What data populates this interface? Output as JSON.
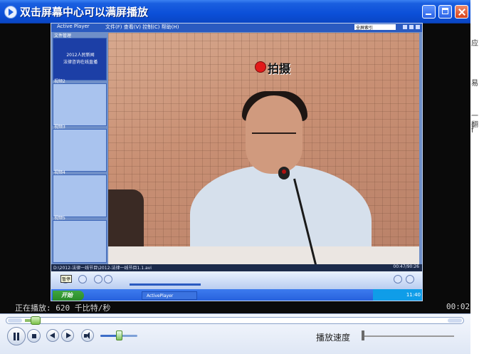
{
  "window": {
    "title": "双击屏幕中心可以满屏播放"
  },
  "inner_screen": {
    "app_name": "Active Player",
    "menu": "文件(F)  查看(V)  控制(C)  帮助(H)",
    "select_value": "全屏索引",
    "thumbs": [
      {
        "label": "文件管理",
        "lines": [
          "2012人民新闻",
          "法律咨询在线直播"
        ]
      },
      {
        "label": "视频2",
        "lines": []
      },
      {
        "label": "视频3",
        "lines": []
      },
      {
        "label": "视频4",
        "lines": []
      },
      {
        "label": "视频5",
        "lines": []
      }
    ],
    "recording_text": "拍摄",
    "status_left": "D:\\2012-法律一线节目\\2012-法律一线节目1.1.avi",
    "status_right": "00:47/90:26",
    "tooltip": "暂停",
    "start_label": "开始",
    "task_item": "ActivePlayer",
    "tray_time": "11:40"
  },
  "status": {
    "playing": "正在播放: 620 千比特/秒",
    "time": "00:02"
  },
  "controls": {
    "seek_fraction": 0.02,
    "volume_fraction": 0.45,
    "speed_label": "播放速度"
  },
  "desktop_right": [
    "应",
    "易",
    "一",
    "翻",
    "f"
  ]
}
